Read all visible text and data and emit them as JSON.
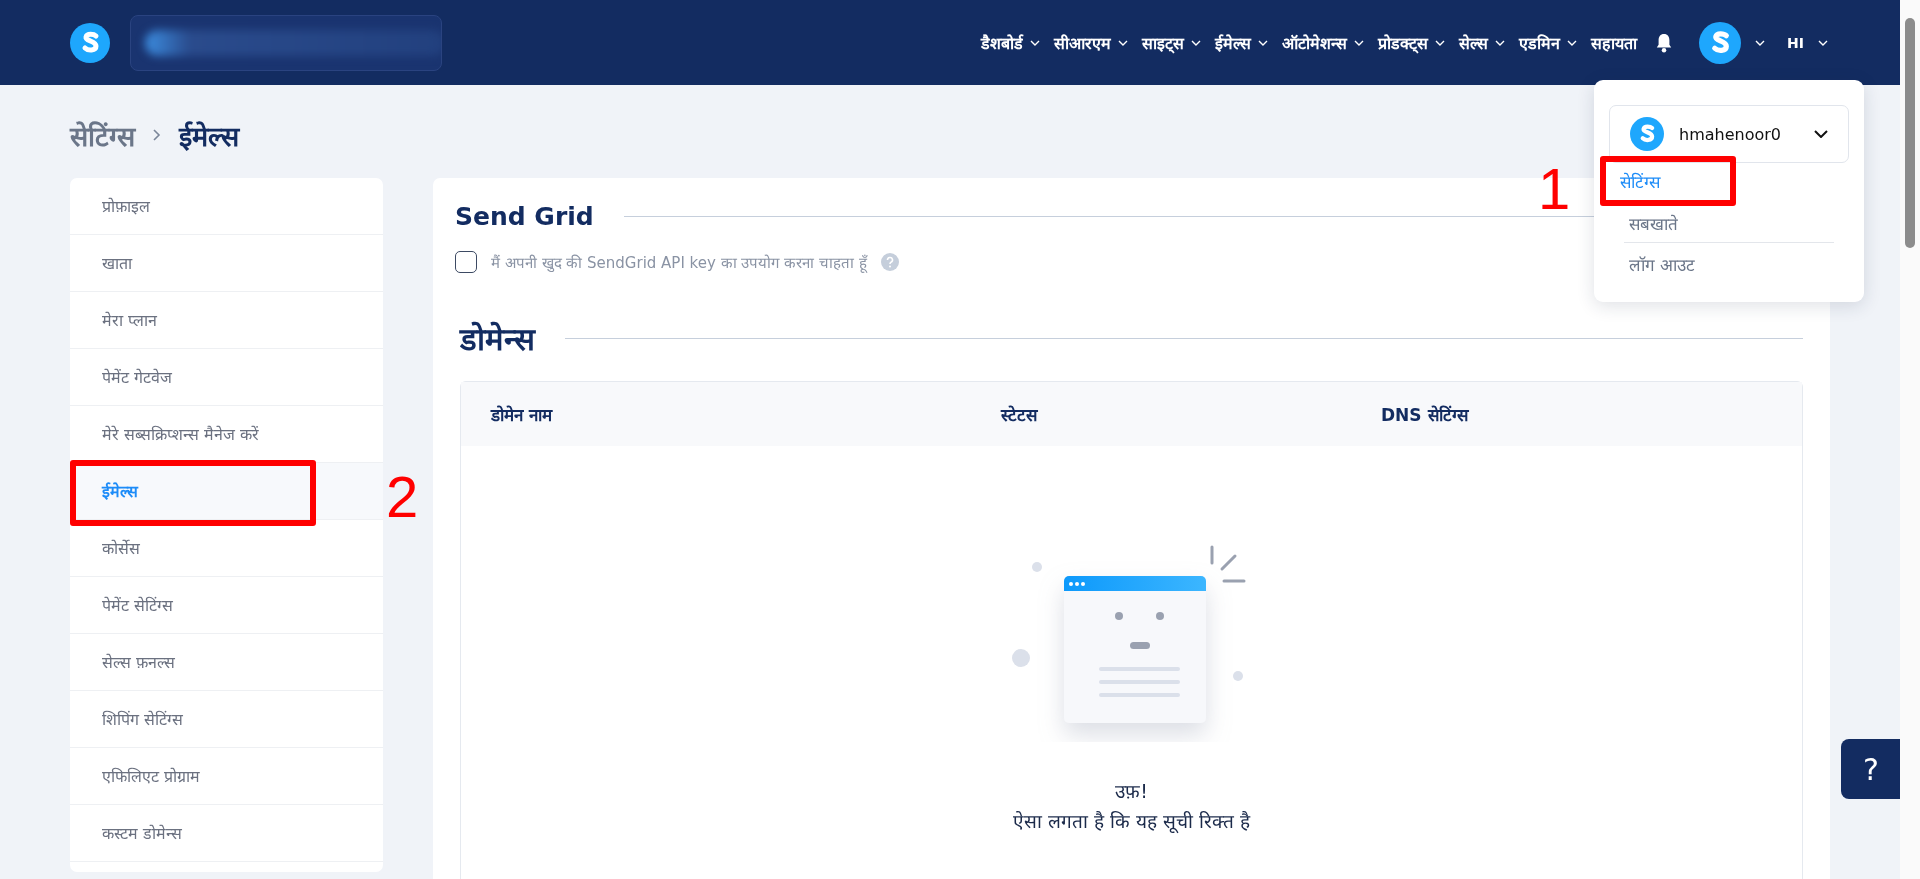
{
  "nav": {
    "items": [
      {
        "label": "डैशबोर्ड",
        "dropdown": true
      },
      {
        "label": "सीआरएम",
        "dropdown": true
      },
      {
        "label": "साइट्स",
        "dropdown": true
      },
      {
        "label": "ईमेल्स",
        "dropdown": true
      },
      {
        "label": "ऑटोमेशन्स",
        "dropdown": true
      },
      {
        "label": "प्रोडक्ट्स",
        "dropdown": true
      },
      {
        "label": "सेल्स",
        "dropdown": true
      },
      {
        "label": "एडमिन",
        "dropdown": true
      },
      {
        "label": "सहायता",
        "dropdown": false
      }
    ],
    "user_initials": "HI"
  },
  "breadcrumb": [
    {
      "label": "सेटिंग्स",
      "current": false
    },
    {
      "label": "ईमेल्स",
      "current": true
    }
  ],
  "sidebar": {
    "items": [
      {
        "label": "प्रोफ़ाइल",
        "selected": false
      },
      {
        "label": "खाता",
        "selected": false
      },
      {
        "label": "मेरा प्लान",
        "selected": false
      },
      {
        "label": "पेमेंट गेटवेज",
        "selected": false
      },
      {
        "label": "मेरे सब्सक्रिप्शन्स मैनेज करें",
        "selected": false
      },
      {
        "label": "ईमेल्स",
        "selected": true
      },
      {
        "label": "कोर्सेस",
        "selected": false
      },
      {
        "label": "पेमेंट सेटिंग्स",
        "selected": false
      },
      {
        "label": "सेल्स फ़नल्स",
        "selected": false
      },
      {
        "label": "शिपिंग सेटिंग्स",
        "selected": false
      },
      {
        "label": "एफिलिएट प्रोग्राम",
        "selected": false
      },
      {
        "label": "कस्टम डोमेन्स",
        "selected": false
      }
    ]
  },
  "sendgrid": {
    "title": "Send Grid",
    "checkbox": {
      "label": "मैं अपनी खुद की SendGrid API key का उपयोग करना चाहता हूँ",
      "checked": false
    }
  },
  "domains": {
    "title": "डोमेन्स",
    "table": {
      "columns": [
        "डोमेन नाम",
        "स्टेटस",
        "DNS सेटिंग्स"
      ]
    },
    "empty": {
      "title": "उफ़!",
      "message": "ऐसा लगता है कि यह सूची रिक्त है"
    }
  },
  "user_menu": {
    "username": "hmahenoor0",
    "items": [
      {
        "label": "सेटिंग्स",
        "selected": true
      },
      {
        "label": "सबखाते",
        "selected": false
      },
      {
        "label": "लॉग आउट",
        "selected": false
      }
    ]
  },
  "annotations": [
    {
      "label": "1"
    },
    {
      "label": "2"
    }
  ],
  "help_button": {
    "label": "?"
  }
}
